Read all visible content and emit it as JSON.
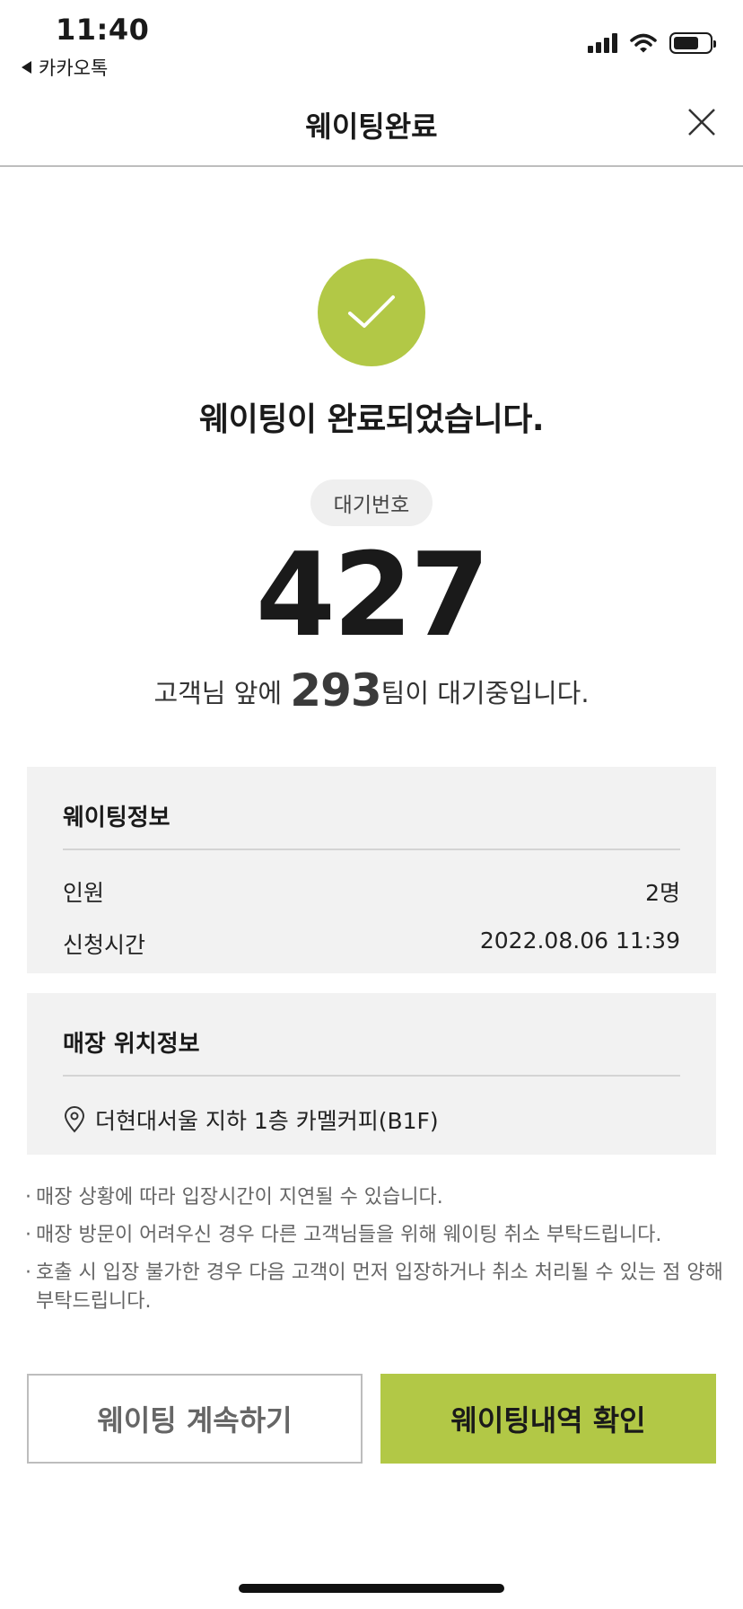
{
  "status_bar": {
    "time": "11:40",
    "back_app": "카카오톡"
  },
  "header": {
    "title": "웨이팅완료"
  },
  "success": {
    "message": "웨이팅이 완료되었습니다.",
    "accent_color": "#b2c846"
  },
  "queue": {
    "pill_label": "대기번호",
    "number": "427",
    "ahead_prefix": "고객님 앞에 ",
    "ahead_count": "293",
    "ahead_suffix": "팀이 대기중입니다."
  },
  "waiting_info": {
    "title": "웨이팅정보",
    "rows": [
      {
        "label": "인원",
        "value": "2명"
      },
      {
        "label": "신청시간",
        "value": "2022.08.06 11:39"
      }
    ]
  },
  "location_info": {
    "title": "매장 위치정보",
    "address": "더현대서울 지하 1층 카멜커피(B1F)"
  },
  "notes": [
    "매장 상황에 따라 입장시간이 지연될 수 있습니다.",
    "매장 방문이 어려우신 경우 다른 고객님들을 위해 웨이팅 취소 부탁드립니다.",
    "호출 시 입장 불가한 경우 다음 고객이 먼저 입장하거나 취소 처리될 수 있는 점 양해 부탁드립니다."
  ],
  "buttons": {
    "continue_label": "웨이팅 계속하기",
    "history_label": "웨이팅내역 확인"
  },
  "icons": {
    "close": "close-icon",
    "check": "check-icon",
    "location": "location-pin-icon"
  }
}
